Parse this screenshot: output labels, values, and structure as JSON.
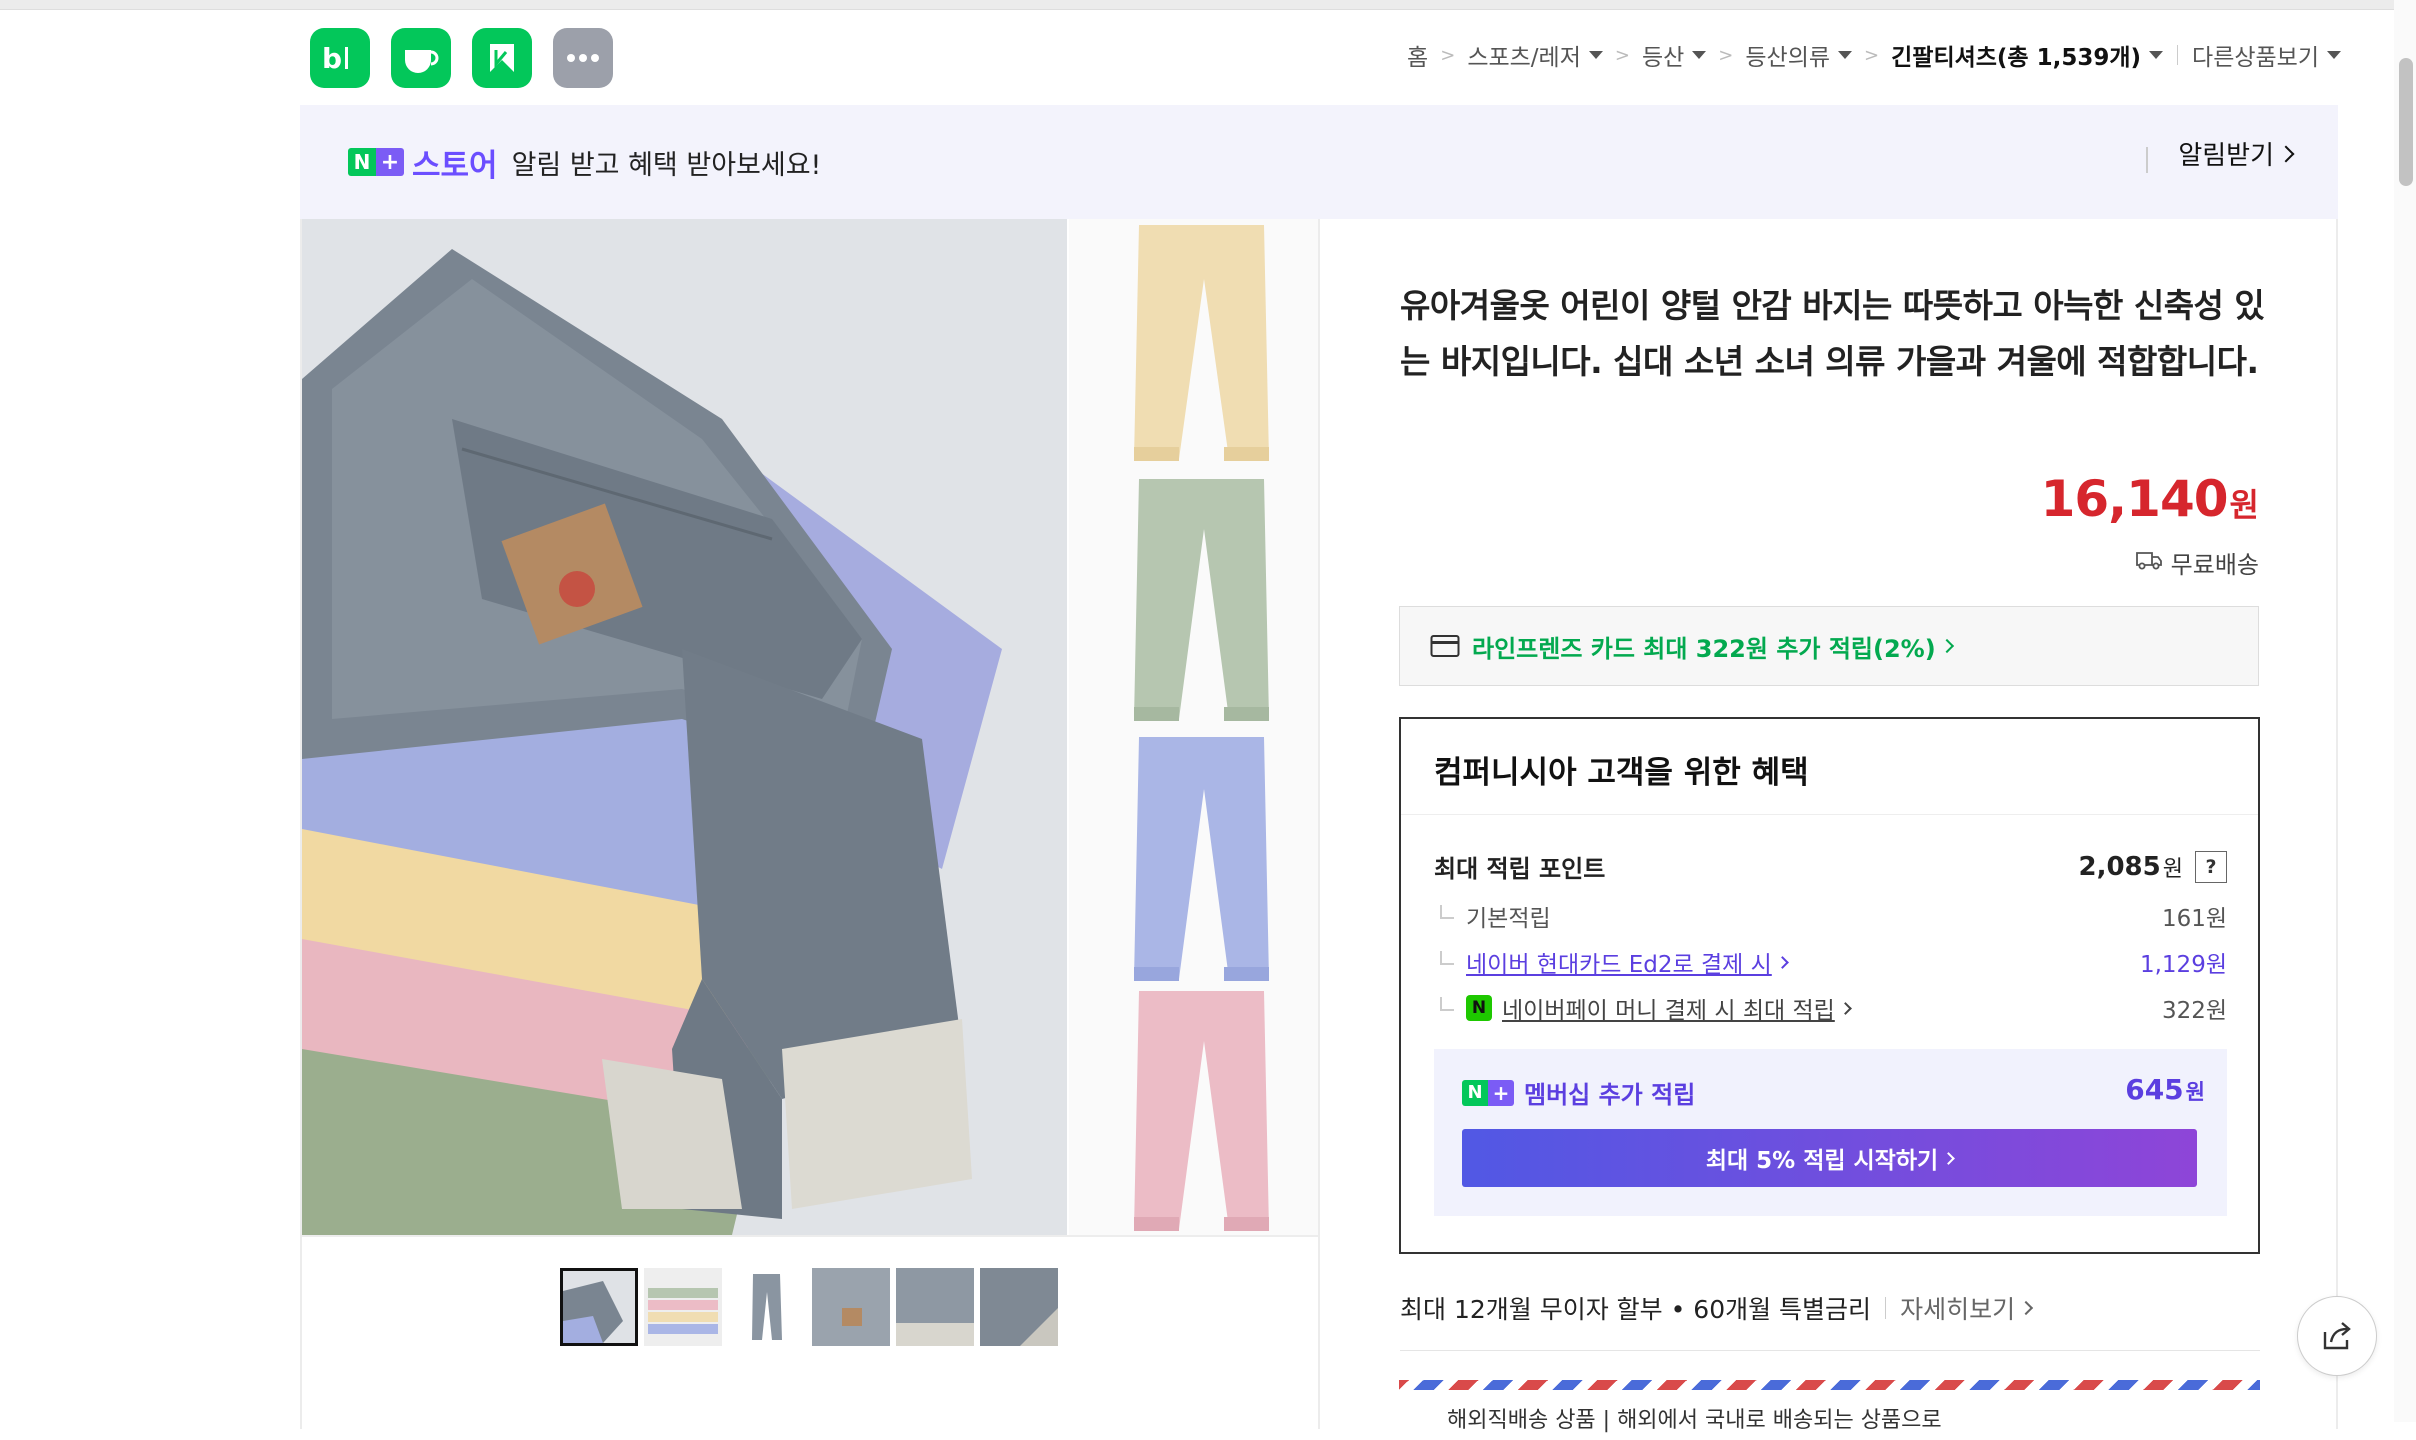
{
  "app_icons": [
    {
      "name": "blog-icon",
      "glyph": "b|",
      "color": "#03c75a"
    },
    {
      "name": "cafe-icon",
      "glyph": "cup",
      "color": "#03c75a"
    },
    {
      "name": "kream-icon",
      "glyph": "K",
      "color": "#03c75a"
    },
    {
      "name": "more-apps-icon",
      "glyph": "•••",
      "color": "#9ca0aa"
    }
  ],
  "breadcrumb": {
    "home": "홈",
    "items": [
      "스포츠/레저",
      "등산",
      "등산의류"
    ],
    "current": "긴팔티셔츠(총 1,539개)",
    "other": "다른상품보기"
  },
  "banner": {
    "n_letter": "N",
    "plus": "+",
    "store_word": "스토어",
    "text": "알림 받고 혜택 받아보세요!",
    "alarm_button": "알림받기"
  },
  "product": {
    "title": "유아겨울옷 어린이 양털 안감 바지는 따뜻하고 아늑한 신축성 있는 바지입니다. 십대 소년 소녀 의류 가을과 겨울에 적합합니다.",
    "price": "16,140",
    "currency": "원",
    "shipping": "무료배송"
  },
  "card_promo": "라인프렌즈 카드 최대 322원 추가 적립(2%)",
  "benefits": {
    "title": "컴퍼니시아 고객을 위한 혜택",
    "max_points_label": "최대 적립 포인트",
    "max_points_value": "2,085",
    "max_points_unit": "원",
    "help": "?",
    "basic_label": "기본적립",
    "basic_value": "161원",
    "hyundai_label": "네이버 현대카드 Ed2로 결제 시",
    "hyundai_value": "1,129원",
    "npay_label": "네이버페이 머니 결제 시 최대 적립",
    "npay_value": "322원",
    "membership_label": "멤버십 추가 적립",
    "membership_value": "645",
    "membership_unit": "원",
    "membership_button": "최대 5% 적립 시작하기"
  },
  "installment": {
    "text": "최대 12개월 무이자 할부 • 60개월 특별금리",
    "link": "자세히보기"
  },
  "airmail_text": "해외직배송 상품 | 해외에서 국내로 배송되는 상품으로",
  "colors": {
    "accent_green": "#03c75a",
    "accent_purple": "#6b4eff",
    "price_red": "#d6262d"
  }
}
